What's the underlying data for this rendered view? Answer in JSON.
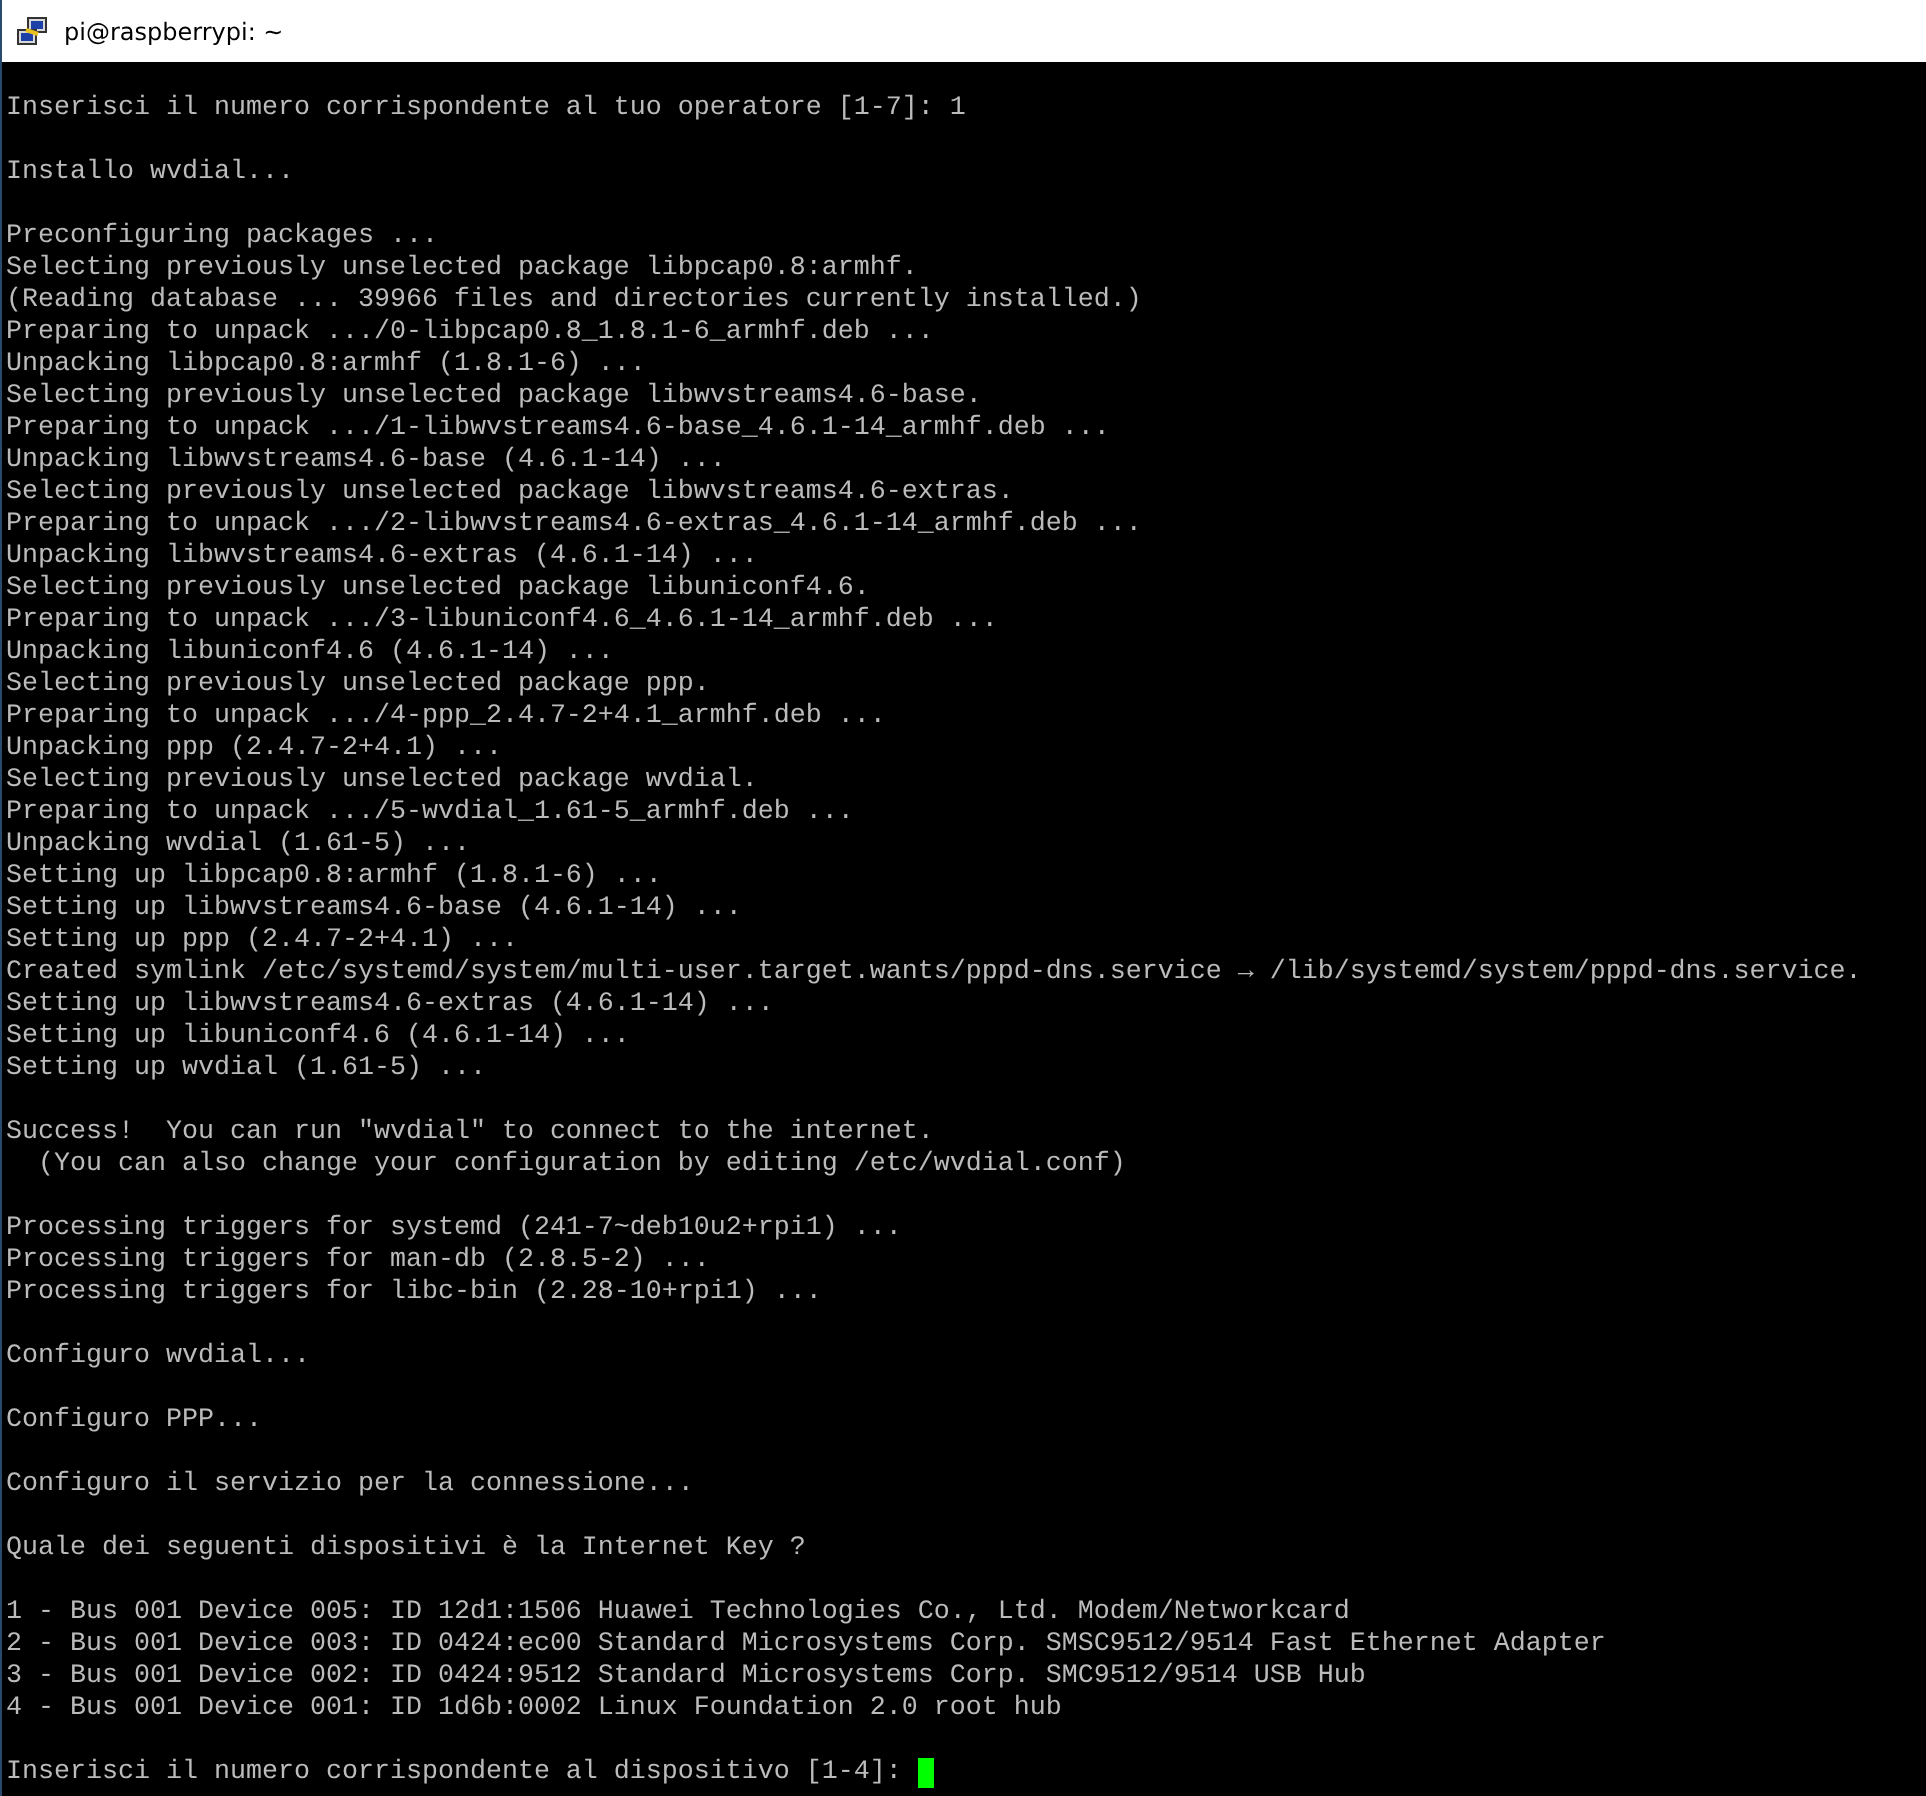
{
  "window": {
    "title": "pi@raspberrypi: ~"
  },
  "terminal": {
    "blocks": [
      {
        "lines": [
          "Inserisci il numero corrispondente al tuo operatore [1-7]: 1"
        ]
      },
      {
        "lines": [
          "Installo wvdial..."
        ]
      },
      {
        "lines": [
          "Preconfiguring packages ...",
          "Selecting previously unselected package libpcap0.8:armhf.",
          "(Reading database ... 39966 files and directories currently installed.)",
          "Preparing to unpack .../0-libpcap0.8_1.8.1-6_armhf.deb ...",
          "Unpacking libpcap0.8:armhf (1.8.1-6) ...",
          "Selecting previously unselected package libwvstreams4.6-base.",
          "Preparing to unpack .../1-libwvstreams4.6-base_4.6.1-14_armhf.deb ...",
          "Unpacking libwvstreams4.6-base (4.6.1-14) ...",
          "Selecting previously unselected package libwvstreams4.6-extras.",
          "Preparing to unpack .../2-libwvstreams4.6-extras_4.6.1-14_armhf.deb ...",
          "Unpacking libwvstreams4.6-extras (4.6.1-14) ...",
          "Selecting previously unselected package libuniconf4.6.",
          "Preparing to unpack .../3-libuniconf4.6_4.6.1-14_armhf.deb ...",
          "Unpacking libuniconf4.6 (4.6.1-14) ...",
          "Selecting previously unselected package ppp.",
          "Preparing to unpack .../4-ppp_2.4.7-2+4.1_armhf.deb ...",
          "Unpacking ppp (2.4.7-2+4.1) ...",
          "Selecting previously unselected package wvdial.",
          "Preparing to unpack .../5-wvdial_1.61-5_armhf.deb ...",
          "Unpacking wvdial (1.61-5) ...",
          "Setting up libpcap0.8:armhf (1.8.1-6) ...",
          "Setting up libwvstreams4.6-base (4.6.1-14) ...",
          "Setting up ppp (2.4.7-2+4.1) ...",
          "Created symlink /etc/systemd/system/multi-user.target.wants/pppd-dns.service → /lib/systemd/system/pppd-dns.service.",
          "Setting up libwvstreams4.6-extras (4.6.1-14) ...",
          "Setting up libuniconf4.6 (4.6.1-14) ...",
          "Setting up wvdial (1.61-5) ..."
        ]
      },
      {
        "lines": [
          "Success!  You can run \"wvdial\" to connect to the internet.",
          "  (You can also change your configuration by editing /etc/wvdial.conf)"
        ]
      },
      {
        "lines": [
          "Processing triggers for systemd (241-7~deb10u2+rpi1) ...",
          "Processing triggers for man-db (2.8.5-2) ...",
          "Processing triggers for libc-bin (2.28-10+rpi1) ..."
        ]
      },
      {
        "lines": [
          "Configuro wvdial..."
        ]
      },
      {
        "lines": [
          "Configuro PPP..."
        ]
      },
      {
        "lines": [
          "Configuro il servizio per la connessione..."
        ]
      },
      {
        "lines": [
          "Quale dei seguenti dispositivi è la Internet Key ?"
        ]
      },
      {
        "lines": [
          "1 - Bus 001 Device 005: ID 12d1:1506 Huawei Technologies Co., Ltd. Modem/Networkcard",
          "2 - Bus 001 Device 003: ID 0424:ec00 Standard Microsystems Corp. SMSC9512/9514 Fast Ethernet Adapter",
          "3 - Bus 001 Device 002: ID 0424:9512 Standard Microsystems Corp. SMC9512/9514 USB Hub",
          "4 - Bus 001 Device 001: ID 1d6b:0002 Linux Foundation 2.0 root hub"
        ]
      },
      {
        "lines": [
          "Inserisci il numero corrispondente al dispositivo [1-4]: "
        ],
        "cursor": true
      }
    ]
  }
}
